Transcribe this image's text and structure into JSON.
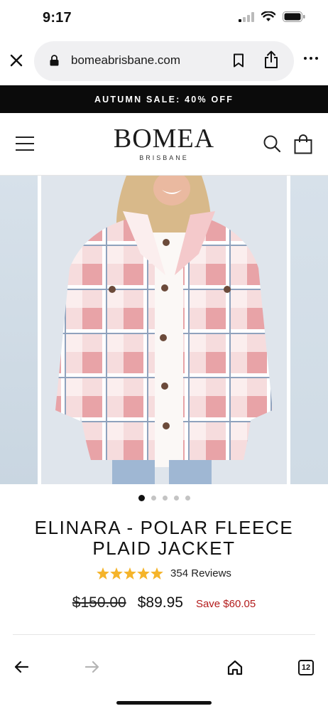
{
  "status_bar": {
    "time": "9:17"
  },
  "browser": {
    "url": "bomeabrisbane.com",
    "tab_count": "12"
  },
  "announcement": {
    "text": "AUTUMN SALE: 40% OFF"
  },
  "header": {
    "logo": "BOMEA",
    "logo_sub": "BRISBANE"
  },
  "gallery": {
    "slide_count": 5,
    "active_index": 0
  },
  "product": {
    "title_line1": "ELINARA - POLAR FLEECE",
    "title_line2": "PLAID JACKET",
    "rating": 5,
    "reviews": "354 Reviews",
    "old_price": "$150.00",
    "price": "$89.95",
    "save": "Save $60.05"
  },
  "colors": {
    "accent_sale": "#b31c1c",
    "star": "#f5b42a",
    "jacket_pink": "#e9a3a8"
  }
}
